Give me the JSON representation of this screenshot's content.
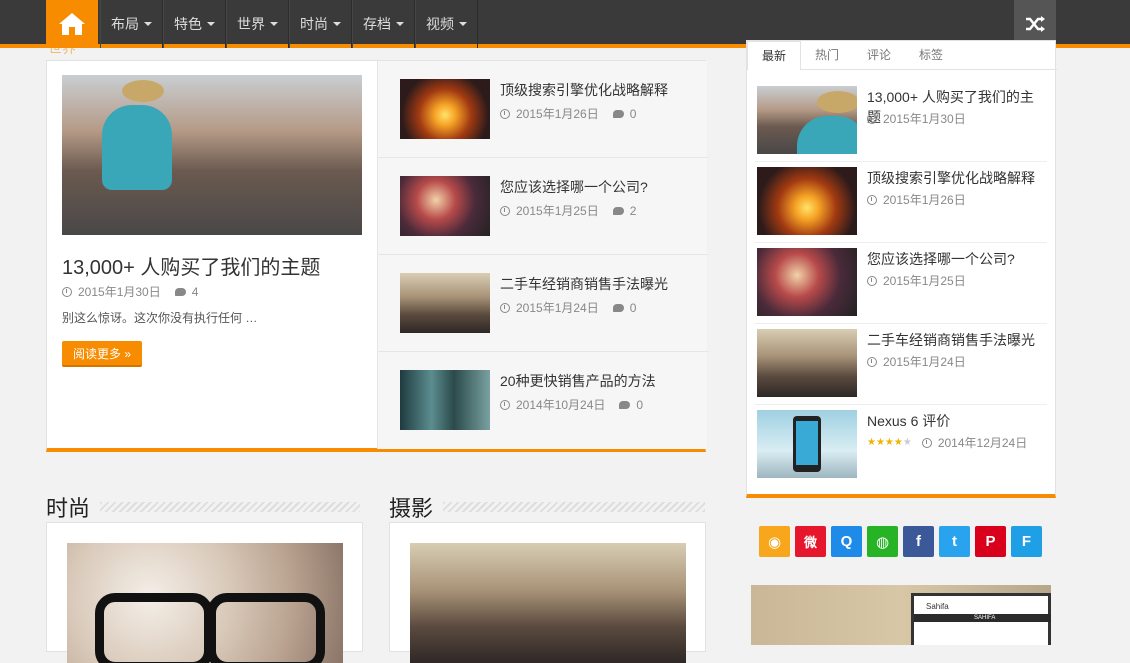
{
  "nav": {
    "items": [
      {
        "label": "布局"
      },
      {
        "label": "特色"
      },
      {
        "label": "世界"
      },
      {
        "label": "时尚"
      },
      {
        "label": "存档"
      },
      {
        "label": "视频"
      }
    ],
    "ghost_label": "世界"
  },
  "featured": {
    "main": {
      "title": "13,000+ 人购买了我们的主题",
      "date": "2015年1月30日",
      "comments": "4",
      "excerpt": "别这么惊讶。这次你没有执行任何 …",
      "button": "阅读更多 »"
    },
    "list": [
      {
        "title": "顶级搜索引擎优化战略解释",
        "date": "2015年1月26日",
        "comments": "0"
      },
      {
        "title": "您应该选择哪一个公司?",
        "date": "2015年1月25日",
        "comments": "2"
      },
      {
        "title": "二手车经销商销售手法曝光",
        "date": "2015年1月24日",
        "comments": "0"
      },
      {
        "title": "20种更快销售产品的方法",
        "date": "2014年10月24日",
        "comments": "0"
      }
    ]
  },
  "sections": {
    "fashion": {
      "title": "时尚"
    },
    "photo": {
      "title": "摄影"
    }
  },
  "sidebar": {
    "tabs": [
      {
        "label": "最新"
      },
      {
        "label": "热门"
      },
      {
        "label": "评论"
      },
      {
        "label": "标签"
      }
    ],
    "items": [
      {
        "title": "13,000+ 人购买了我们的主题",
        "date": "2015年1月30日"
      },
      {
        "title": "顶级搜索引擎优化战略解释",
        "date": "2015年1月26日"
      },
      {
        "title": "您应该选择哪一个公司?",
        "date": "2015年1月25日"
      },
      {
        "title": "二手车经销商销售手法曝光",
        "date": "2015年1月24日"
      },
      {
        "title": "Nexus 6 评价",
        "date": "2014年12月24日",
        "rating_stars": 4
      }
    ]
  },
  "social": {
    "buttons": [
      {
        "name": "rss-icon",
        "glyph": "◉",
        "color": "#f8a61b"
      },
      {
        "name": "weibo-icon",
        "glyph": "微",
        "color": "#e6162d"
      },
      {
        "name": "qq-icon",
        "glyph": "Q",
        "color": "#1e8be8"
      },
      {
        "name": "wechat-icon",
        "glyph": "◍",
        "color": "#27b326"
      },
      {
        "name": "facebook-icon",
        "glyph": "f",
        "color": "#3b5998"
      },
      {
        "name": "twitter-icon",
        "glyph": "t",
        "color": "#2aa3ef"
      },
      {
        "name": "pinterest-icon",
        "glyph": "P",
        "color": "#d9001b"
      },
      {
        "name": "foursquare-icon",
        "glyph": "F",
        "color": "#1fa0e6"
      }
    ]
  },
  "ad": {
    "brand": "Sahifa",
    "screen_tag": "SAHIFA"
  },
  "colors": {
    "accent": "#f88c00",
    "nav_bg": "#3a3a3a"
  }
}
